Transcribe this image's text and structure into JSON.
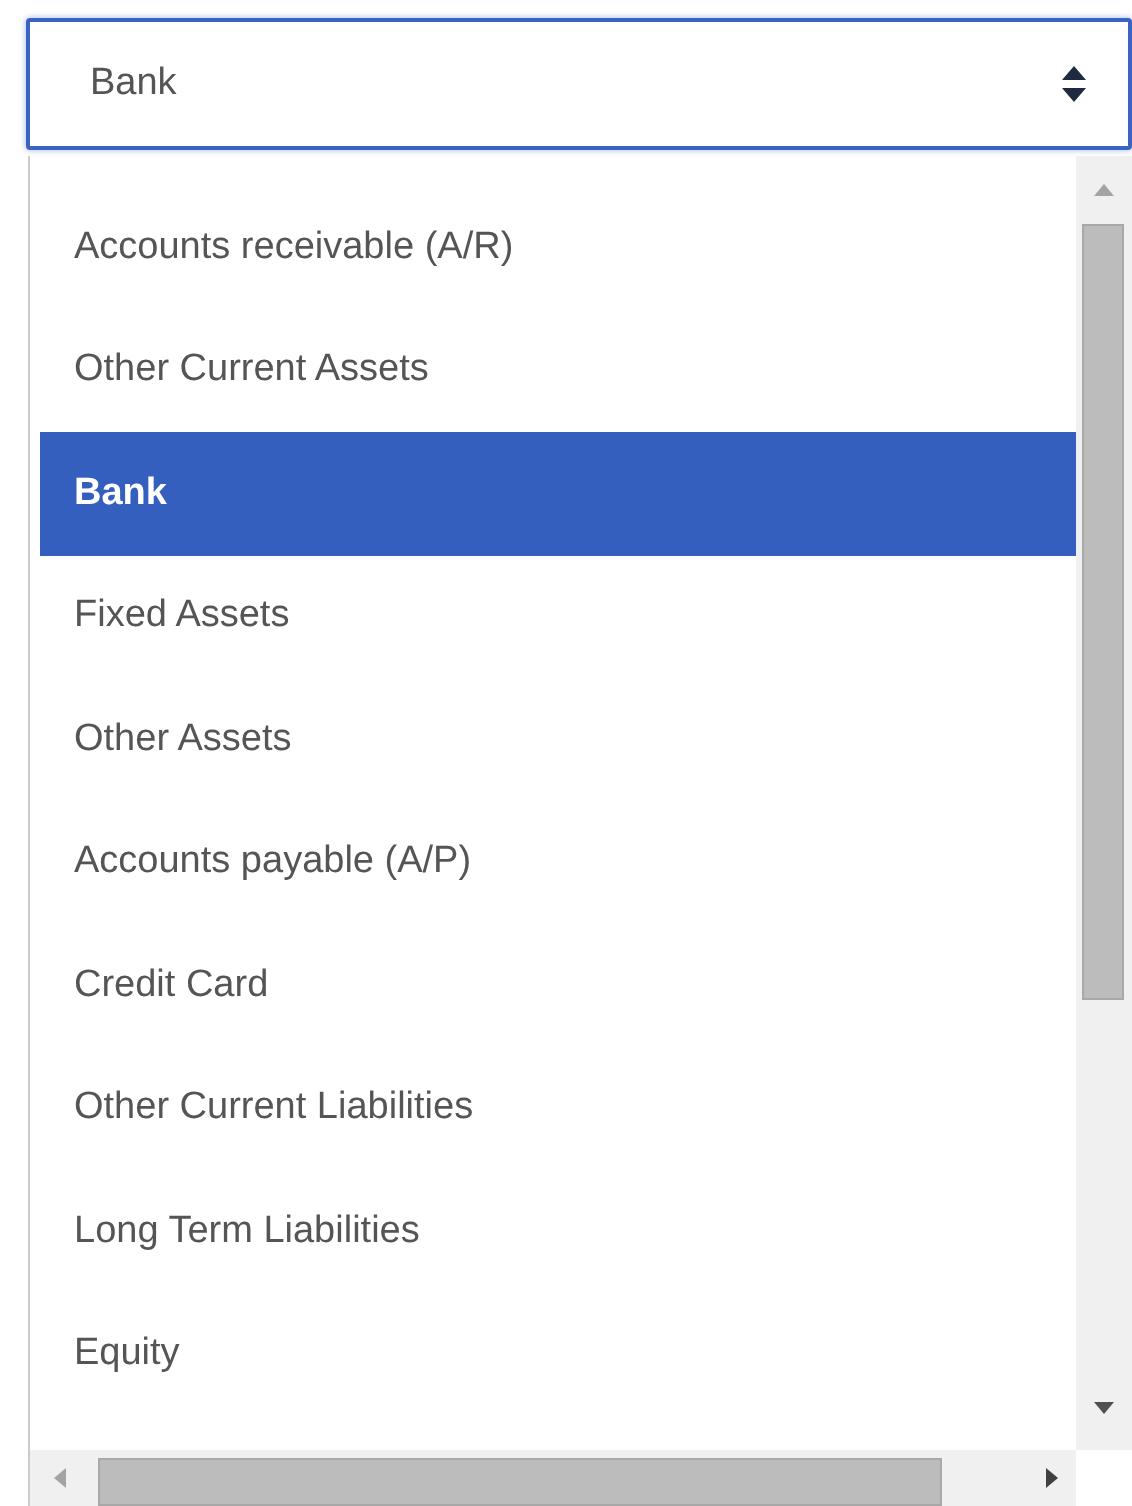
{
  "select": {
    "value": "Bank"
  },
  "options": [
    {
      "label": "Accounts receivable (A/R)",
      "selected": false
    },
    {
      "label": "Other Current Assets",
      "selected": false
    },
    {
      "label": "Bank",
      "selected": true
    },
    {
      "label": "Fixed Assets",
      "selected": false
    },
    {
      "label": "Other Assets",
      "selected": false
    },
    {
      "label": "Accounts payable (A/P)",
      "selected": false
    },
    {
      "label": "Credit Card",
      "selected": false
    },
    {
      "label": "Other Current Liabilities",
      "selected": false
    },
    {
      "label": "Long Term Liabilities",
      "selected": false
    },
    {
      "label": "Equity",
      "selected": false
    }
  ]
}
